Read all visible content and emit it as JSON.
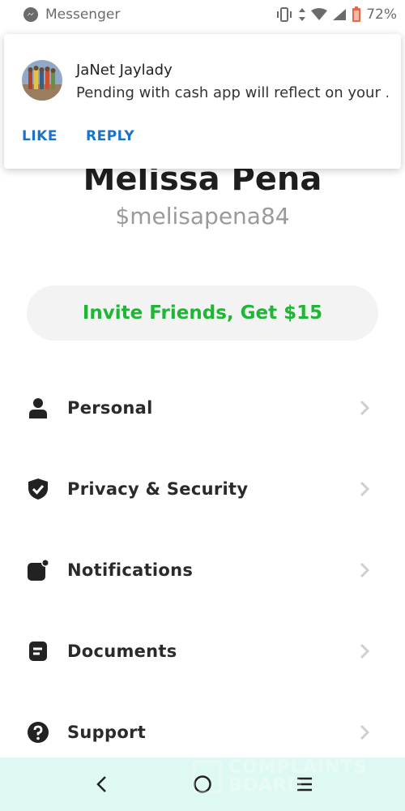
{
  "status_bar": {
    "app_name": "Messenger",
    "battery": "72%"
  },
  "profile": {
    "name": "Melissa Pena",
    "handle": "$melisapena84"
  },
  "invite": {
    "label": "Invite Friends, Get $15",
    "color": "#1fb636"
  },
  "menu": {
    "items": [
      {
        "label": "Personal",
        "icon": "person-icon"
      },
      {
        "label": "Privacy & Security",
        "icon": "shield-icon"
      },
      {
        "label": "Notifications",
        "icon": "notification-icon"
      },
      {
        "label": "Documents",
        "icon": "document-icon"
      },
      {
        "label": "Support",
        "icon": "help-icon"
      }
    ]
  },
  "notification": {
    "sender": "JaNet Jaylady",
    "message": "Pending with cash app will reflect on your ...",
    "actions": {
      "like": "LIKE",
      "reply": "REPLY"
    },
    "action_color": "#1a73c8"
  },
  "watermark": {
    "line1": "COMPLAINTS",
    "line2": "BOARD"
  }
}
